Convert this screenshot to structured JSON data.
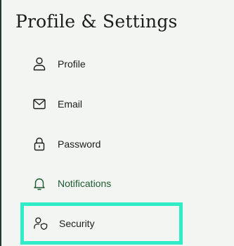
{
  "page": {
    "title": "Profile & Settings"
  },
  "menu": {
    "items": [
      {
        "label": "Profile",
        "icon": "person-icon"
      },
      {
        "label": "Email",
        "icon": "envelope-icon"
      },
      {
        "label": "Password",
        "icon": "padlock-icon"
      },
      {
        "label": "Notifications",
        "icon": "bell-icon",
        "active": true
      },
      {
        "label": "Security",
        "icon": "person-shield-icon",
        "focused": true
      }
    ]
  },
  "colors": {
    "background": "#f3f5f2",
    "text": "#1c1c1c",
    "active": "#1f5a33",
    "focus_ring": "#2fedc6",
    "left_rule": "#1f3b2a"
  }
}
